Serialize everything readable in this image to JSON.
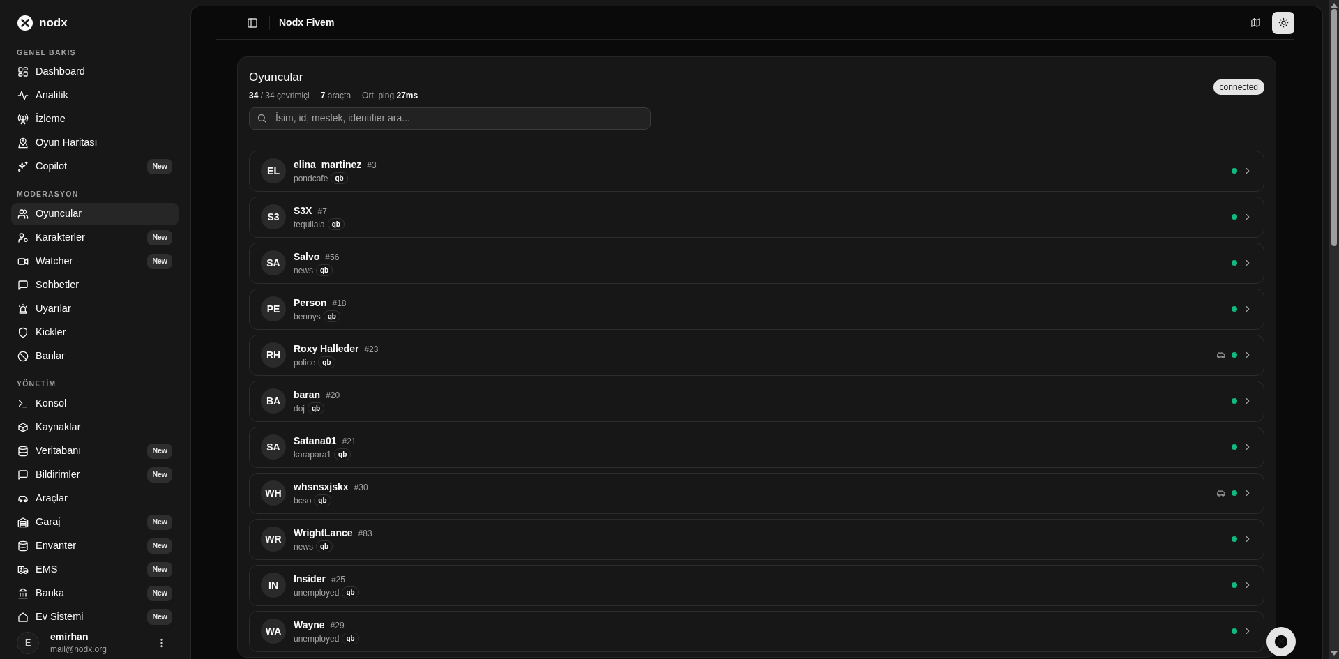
{
  "app": {
    "name": "nodx"
  },
  "sidebar": {
    "sections": [
      {
        "title": "GENEL BAKIŞ",
        "items": [
          {
            "label": "Dashboard",
            "selected": false
          },
          {
            "label": "Analitik",
            "selected": false
          },
          {
            "label": "İzleme",
            "selected": false
          },
          {
            "label": "Oyun Haritası",
            "selected": false
          },
          {
            "label": "Copilot",
            "selected": false,
            "badge": "New"
          }
        ]
      },
      {
        "title": "MODERASYON",
        "items": [
          {
            "label": "Oyuncular",
            "selected": true
          },
          {
            "label": "Karakterler",
            "selected": false,
            "badge": "New"
          },
          {
            "label": "Watcher",
            "selected": false,
            "badge": "New"
          },
          {
            "label": "Sohbetler",
            "selected": false
          },
          {
            "label": "Uyarılar",
            "selected": false
          },
          {
            "label": "Kickler",
            "selected": false
          },
          {
            "label": "Banlar",
            "selected": false
          }
        ]
      },
      {
        "title": "YÖNETİM",
        "items": [
          {
            "label": "Konsol",
            "selected": false
          },
          {
            "label": "Kaynaklar",
            "selected": false
          },
          {
            "label": "Veritabanı",
            "selected": false,
            "badge": "New"
          },
          {
            "label": "Bildirimler",
            "selected": false,
            "badge": "New"
          },
          {
            "label": "Araçlar",
            "selected": false
          },
          {
            "label": "Garaj",
            "selected": false,
            "badge": "New"
          },
          {
            "label": "Envanter",
            "selected": false,
            "badge": "New"
          },
          {
            "label": "EMS",
            "selected": false,
            "badge": "New"
          },
          {
            "label": "Banka",
            "selected": false,
            "badge": "New"
          },
          {
            "label": "Ev Sistemi",
            "selected": false,
            "badge": "New"
          }
        ]
      }
    ]
  },
  "user": {
    "initial": "E",
    "name": "emirhan",
    "email": "mail@nodx.org"
  },
  "header": {
    "title": "Nodx Fivem"
  },
  "players_panel": {
    "title": "Oyuncular",
    "stats": [
      "**34** / 34 çevrimiçi",
      "**7** araçta",
      "Ort. ping **27ms**"
    ],
    "status_badge": "connected",
    "search": {
      "placeholder": "İsim, id, meslek, identifier ara..."
    },
    "players": [
      {
        "initials": "EL",
        "name": "elina_martinez",
        "id": "#3",
        "job": "pondcafe",
        "tag": "qb",
        "in_vehicle": false,
        "online": true
      },
      {
        "initials": "S3",
        "name": "S3X",
        "id": "#7",
        "job": "tequilala",
        "tag": "qb",
        "in_vehicle": false,
        "online": true
      },
      {
        "initials": "SA",
        "name": "Salvo",
        "id": "#56",
        "job": "news",
        "tag": "qb",
        "in_vehicle": false,
        "online": true
      },
      {
        "initials": "PE",
        "name": "Person",
        "id": "#18",
        "job": "bennys",
        "tag": "qb",
        "in_vehicle": false,
        "online": true
      },
      {
        "initials": "RH",
        "name": "Roxy Halleder",
        "id": "#23",
        "job": "police",
        "tag": "qb",
        "in_vehicle": true,
        "online": true
      },
      {
        "initials": "BA",
        "name": "baran",
        "id": "#20",
        "job": "doj",
        "tag": "qb",
        "in_vehicle": false,
        "online": true
      },
      {
        "initials": "SA",
        "name": "Satana01",
        "id": "#21",
        "job": "karapara1",
        "tag": "qb",
        "in_vehicle": false,
        "online": true
      },
      {
        "initials": "WH",
        "name": "whsnsxjskx",
        "id": "#30",
        "job": "bcso",
        "tag": "qb",
        "in_vehicle": true,
        "online": true
      },
      {
        "initials": "WR",
        "name": "WrightLance",
        "id": "#83",
        "job": "news",
        "tag": "qb",
        "in_vehicle": false,
        "online": true
      },
      {
        "initials": "IN",
        "name": "Insider",
        "id": "#25",
        "job": "unemployed",
        "tag": "qb",
        "in_vehicle": false,
        "online": true
      },
      {
        "initials": "WA",
        "name": "Wayne",
        "id": "#29",
        "job": "unemployed",
        "tag": "qb",
        "in_vehicle": false,
        "online": true
      }
    ]
  }
}
